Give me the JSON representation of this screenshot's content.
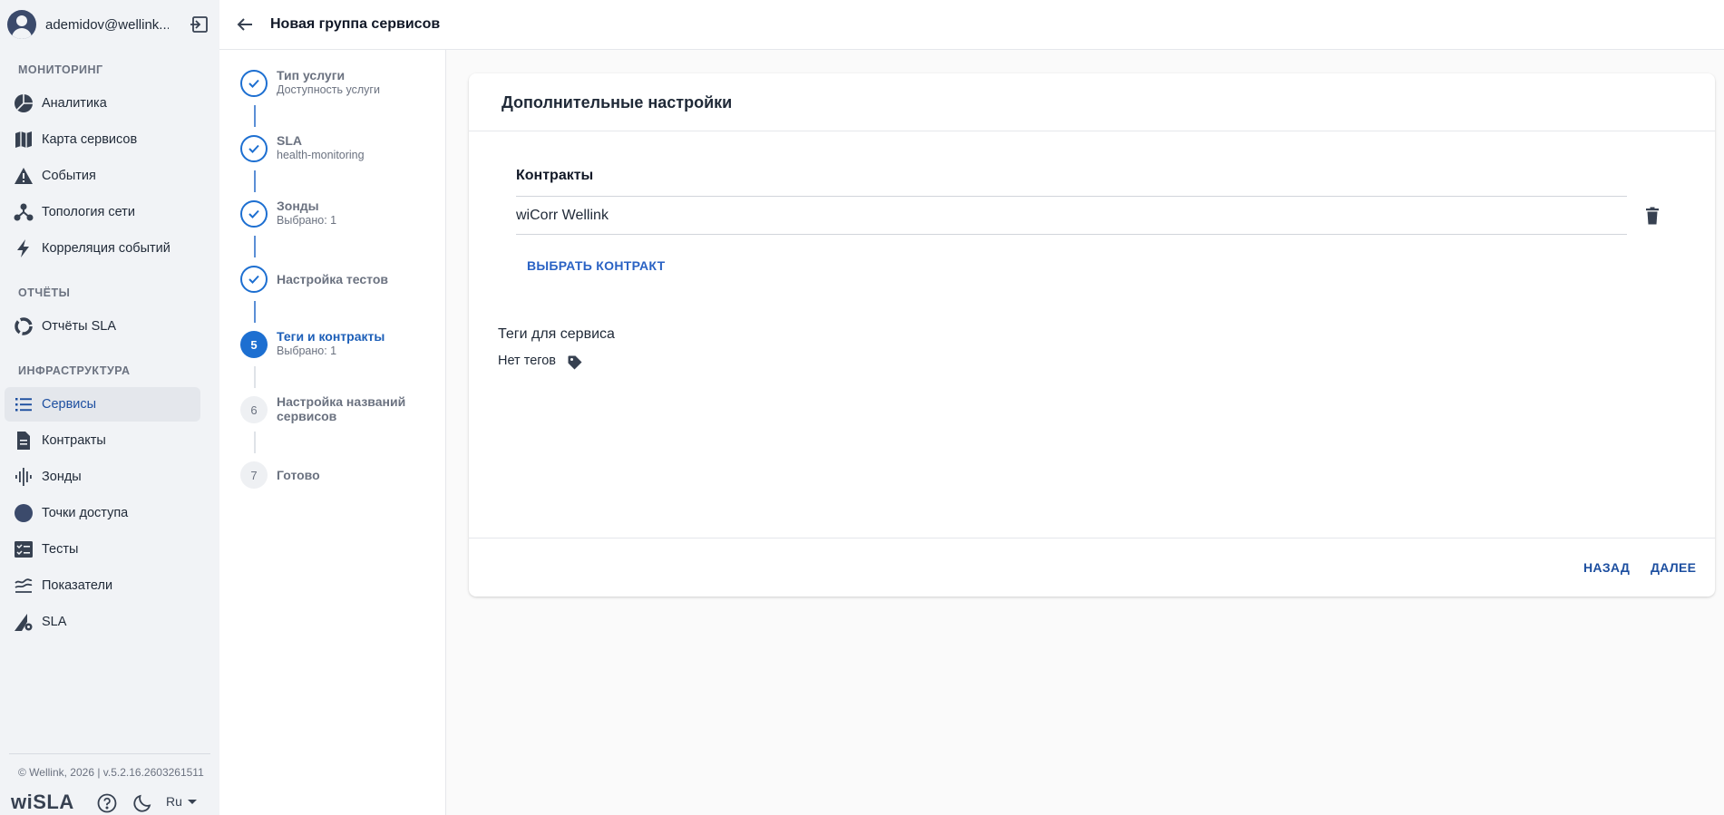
{
  "user": {
    "name": "ademidov@wellink..."
  },
  "sidebar": {
    "sections": [
      {
        "title": "МОНИТОРИНГ"
      },
      {
        "title": "ОТЧЁТЫ"
      },
      {
        "title": "ИНФРАСТРУКТУРА"
      }
    ],
    "items": [
      {
        "label": "Аналитика",
        "icon": "pie-chart-icon"
      },
      {
        "label": "Карта сервисов",
        "icon": "map-icon"
      },
      {
        "label": "События",
        "icon": "warning-icon"
      },
      {
        "label": "Топология сети",
        "icon": "topology-icon"
      },
      {
        "label": "Корреляция событий",
        "icon": "lightning-icon"
      },
      {
        "label": "Отчёты SLA",
        "icon": "donut-icon"
      },
      {
        "label": "Сервисы",
        "icon": "list-icon",
        "active": true
      },
      {
        "label": "Контракты",
        "icon": "document-icon"
      },
      {
        "label": "Зонды",
        "icon": "probe-icon"
      },
      {
        "label": "Точки доступа",
        "icon": "access-point-icon"
      },
      {
        "label": "Тесты",
        "icon": "checklist-icon"
      },
      {
        "label": "Показатели",
        "icon": "metrics-icon"
      },
      {
        "label": "SLA",
        "icon": "sla-settings-icon"
      }
    ],
    "footer": {
      "copyright": "© Wellink, 2026 | v.5.2.16.2603261511",
      "brand": "wiSLA",
      "language": "Ru"
    }
  },
  "header": {
    "title": "Новая группа сервисов"
  },
  "stepper": {
    "steps": [
      {
        "title": "Тип услуги",
        "subtitle": "Доступность услуги",
        "state": "done"
      },
      {
        "title": "SLA",
        "subtitle": "health-monitoring",
        "state": "done"
      },
      {
        "title": "Зонды",
        "subtitle": "Выбрано: 1",
        "state": "done"
      },
      {
        "title": "Настройка тестов",
        "subtitle": "",
        "state": "done"
      },
      {
        "title": "Теги и контракты",
        "subtitle": "Выбрано: 1",
        "state": "current",
        "number": "5"
      },
      {
        "title": "Настройка названий сервисов",
        "subtitle": "",
        "state": "pending",
        "number": "6"
      },
      {
        "title": "Готово",
        "subtitle": "",
        "state": "pending",
        "number": "7"
      }
    ]
  },
  "card": {
    "title": "Дополнительные настройки",
    "contracts_label": "Контракты",
    "contract_name": "wiCorr Wellink",
    "choose_contract": "ВЫБРАТЬ КОНТРАКТ",
    "tags_label": "Теги для сервиса",
    "no_tags": "Нет тегов",
    "back": "НАЗАД",
    "next": "ДАЛЕЕ"
  },
  "colors": {
    "accent": "#1d6fd1",
    "link": "#1d4fa0"
  }
}
